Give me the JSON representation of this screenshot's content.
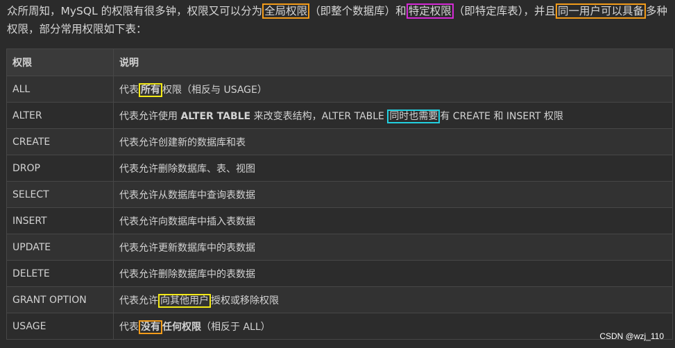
{
  "intro": {
    "p1": "众所周知，MySQL 的权限有很多钟，权限又可以分为",
    "hl1": "全局权限",
    "p2": "（即整个数据库）和",
    "hl2": "特定权限",
    "p3": "（即特定库表），并且",
    "hl3": "同一用户可以具备",
    "p4": "多种权限，部分常用权限如下表："
  },
  "table": {
    "headers": [
      "权限",
      "说明"
    ],
    "rows": [
      {
        "name": "ALL",
        "d": [
          "代表",
          "所有",
          "权限（相反与 USAGE）"
        ]
      },
      {
        "name": "ALTER",
        "d": [
          "代表允许使用 ",
          "ALTER TABLE",
          " 来改变表结构，ALTER TABLE ",
          "同时也需要",
          "有 CREATE 和 INSERT 权限"
        ]
      },
      {
        "name": "CREATE",
        "d": [
          "代表允许创建新的数据库和表"
        ]
      },
      {
        "name": "DROP",
        "d": [
          "代表允许删除数据库、表、视图"
        ]
      },
      {
        "name": "SELECT",
        "d": [
          "代表允许从数据库中查询表数据"
        ]
      },
      {
        "name": "INSERT",
        "d": [
          "代表允许向数据库中插入表数据"
        ]
      },
      {
        "name": "UPDATE",
        "d": [
          "代表允许更新数据库中的表数据"
        ]
      },
      {
        "name": "DELETE",
        "d": [
          "代表允许删除数据库中的表数据"
        ]
      },
      {
        "name": "GRANT OPTION",
        "d": [
          "代表允许",
          "向其他用户",
          "授权或移除权限"
        ]
      },
      {
        "name": "USAGE",
        "d": [
          "代表",
          "没有",
          "任何权限",
          "（相反于 ALL）"
        ]
      }
    ]
  },
  "watermark": "CSDN @wzj_110",
  "colors": {
    "orange": "#f39c1a",
    "magenta": "#d62bd6",
    "yellow": "#f4ea16",
    "cyan": "#22d0e0"
  }
}
